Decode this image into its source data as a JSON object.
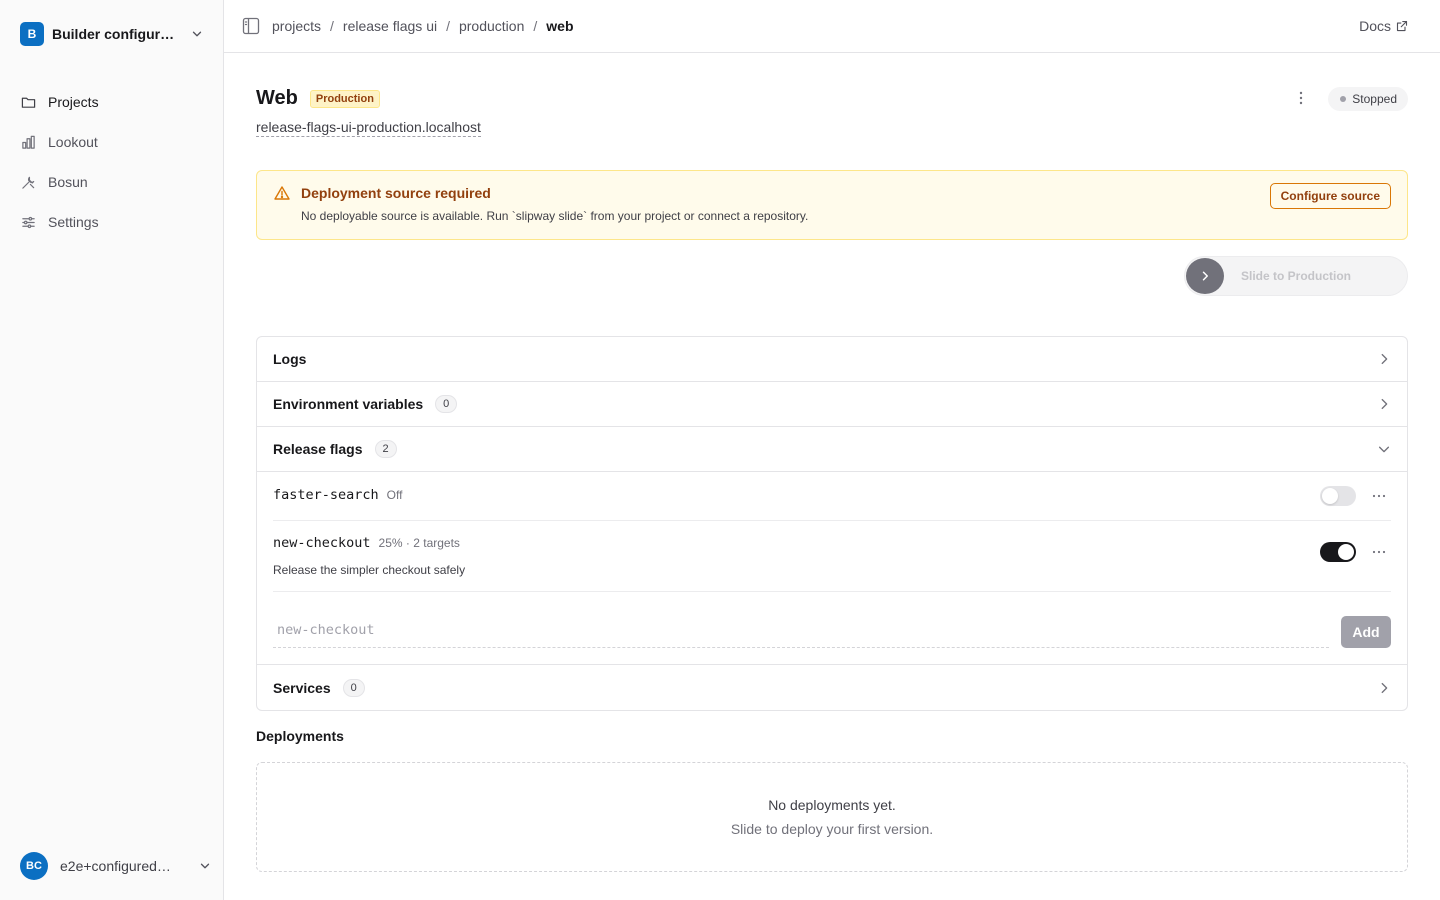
{
  "sidebar": {
    "org": {
      "initial": "B",
      "name": "Builder configured workspace"
    },
    "nav": [
      {
        "label": "Projects",
        "icon": "folder-icon"
      },
      {
        "label": "Lookout",
        "icon": "bar-chart-icon"
      },
      {
        "label": "Bosun",
        "icon": "tools-icon"
      },
      {
        "label": "Settings",
        "icon": "sliders-icon"
      }
    ],
    "user": {
      "initials": "BC",
      "name": "e2e+configured@example.com"
    }
  },
  "topbar": {
    "breadcrumbs": [
      "projects",
      "release flags ui",
      "production",
      "web"
    ],
    "docs_label": "Docs"
  },
  "service": {
    "title": "Web",
    "environment_badge": "Production",
    "hostname": "release-flags-ui-production.localhost",
    "status": "Stopped"
  },
  "alert": {
    "title": "Deployment source required",
    "body": "No deployable source is available. Run `slipway slide` from your project or connect a repository.",
    "button_label": "Configure source"
  },
  "slide_control": {
    "label": "Slide to Production"
  },
  "sections": {
    "logs": {
      "label": "Logs"
    },
    "env_vars": {
      "label": "Environment variables",
      "count": "0"
    },
    "release_flags": {
      "label": "Release flags",
      "count": "2",
      "flags": [
        {
          "key": "faster-search",
          "meta": "Off",
          "description": "",
          "enabled": false
        },
        {
          "key": "new-checkout",
          "meta": "25% · 2 targets",
          "description": "Release the simpler checkout safely",
          "enabled": true
        }
      ],
      "new_flag_placeholder": "new-checkout",
      "add_label": "Add"
    },
    "services": {
      "label": "Services",
      "count": "0"
    }
  },
  "deployments": {
    "title": "Deployments",
    "empty_title": "No deployments yet.",
    "empty_hint": "Slide to deploy your first version."
  },
  "colors": {
    "accent": "#0b6fc2",
    "warning_bg": "#fffbeb",
    "warning_border": "#fde68a",
    "warning_text": "#92400e",
    "toggle_on": "#18181b"
  }
}
